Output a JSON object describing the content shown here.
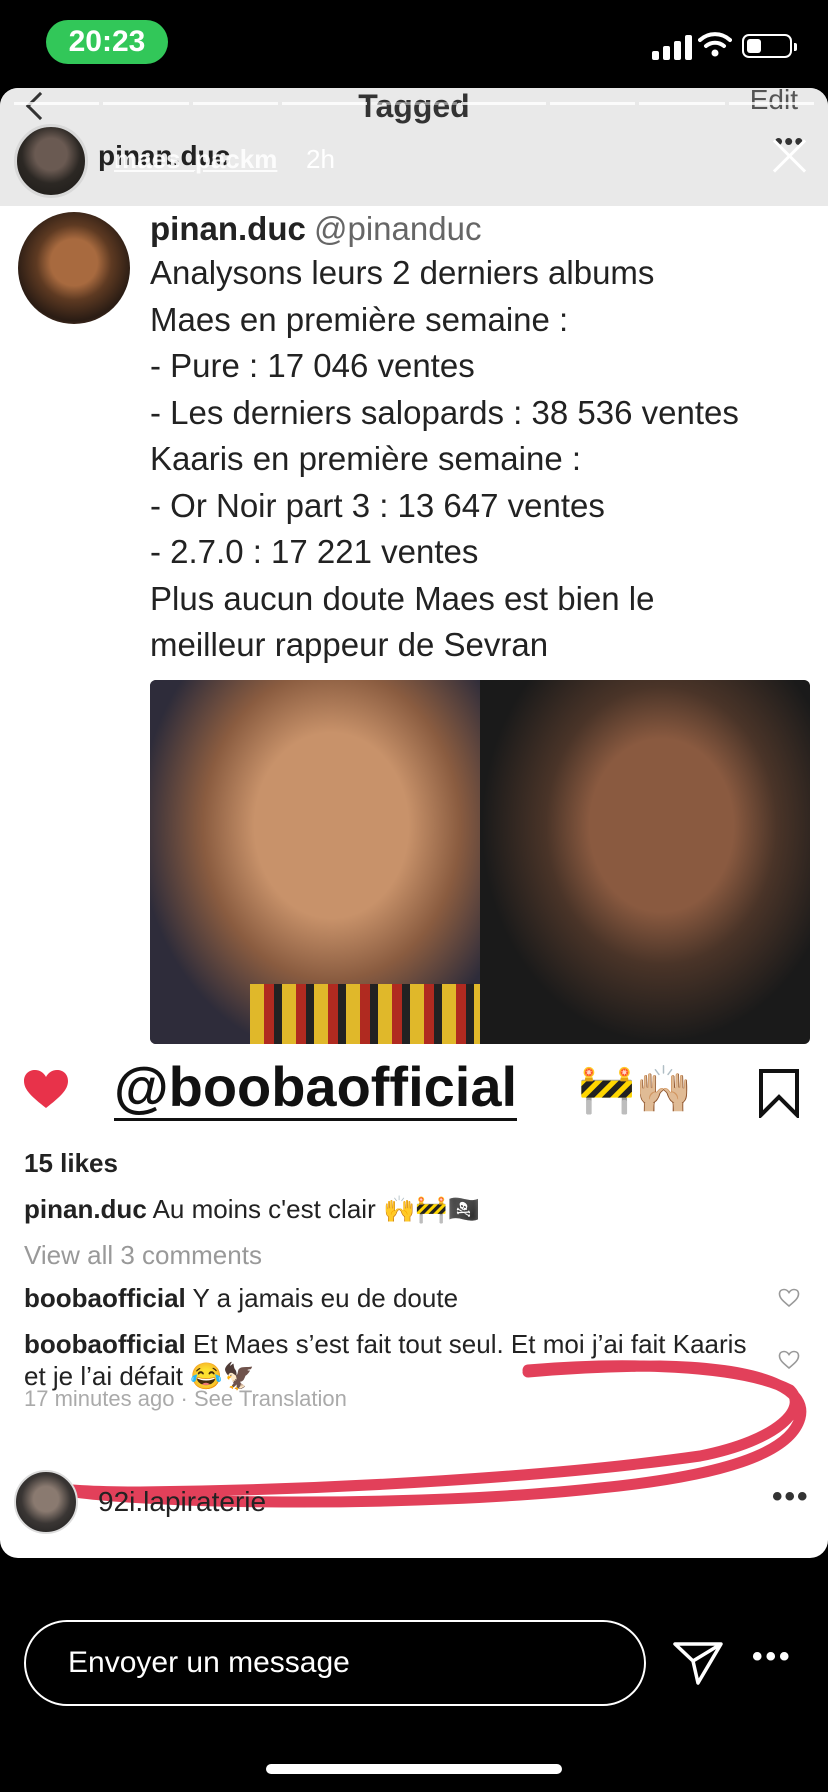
{
  "status_bar": {
    "time": "20:23"
  },
  "story": {
    "header_title": "Tagged",
    "edit_label": "Edit",
    "username": "pinan.duc",
    "tagged_user": "maes_packm",
    "time_ago": "2h",
    "more_label": "•••"
  },
  "tweet": {
    "name": "pinan.duc",
    "handle": "@pinanduc",
    "lines": [
      "Analysons leurs 2 derniers albums",
      "Maes en première semaine :",
      "- Pure : 17 046 ventes",
      "- Les derniers salopards : 38 536 ventes",
      "Kaaris en première semaine :",
      "- Or Noir part 3 : 13 647 ventes",
      "- 2.7.0 : 17 221 ventes",
      "Plus aucun doute Maes est bien le",
      "meilleur rappeur de Sevran"
    ]
  },
  "post": {
    "mention": "@boobaofficial",
    "mention_emoji": "🚧🙌🏼",
    "likes": "15 likes",
    "caption_user": "pinan.duc",
    "caption_text": "Au moins c'est clair 🙌🚧🏴‍☠️",
    "view_all": "View all 3 comments",
    "comments": [
      {
        "user": "boobaofficial",
        "text": "Y a jamais eu de doute"
      },
      {
        "user": "boobaofficial",
        "text": "Et Maes s’est fait tout seul. Et moi j’ai fait Kaaris et je l’ai défait 😂🦅"
      }
    ],
    "comment_meta": "17 minutes ago · See Translation",
    "scribble_color": "#e2405a"
  },
  "next_post": {
    "username": "92i.lapiraterie",
    "more_label": "•••"
  },
  "message_bar": {
    "placeholder": "Envoyer un message",
    "more_label": "•••"
  },
  "colors": {
    "heart": "#e8324a",
    "time_pill": "#32c759"
  }
}
